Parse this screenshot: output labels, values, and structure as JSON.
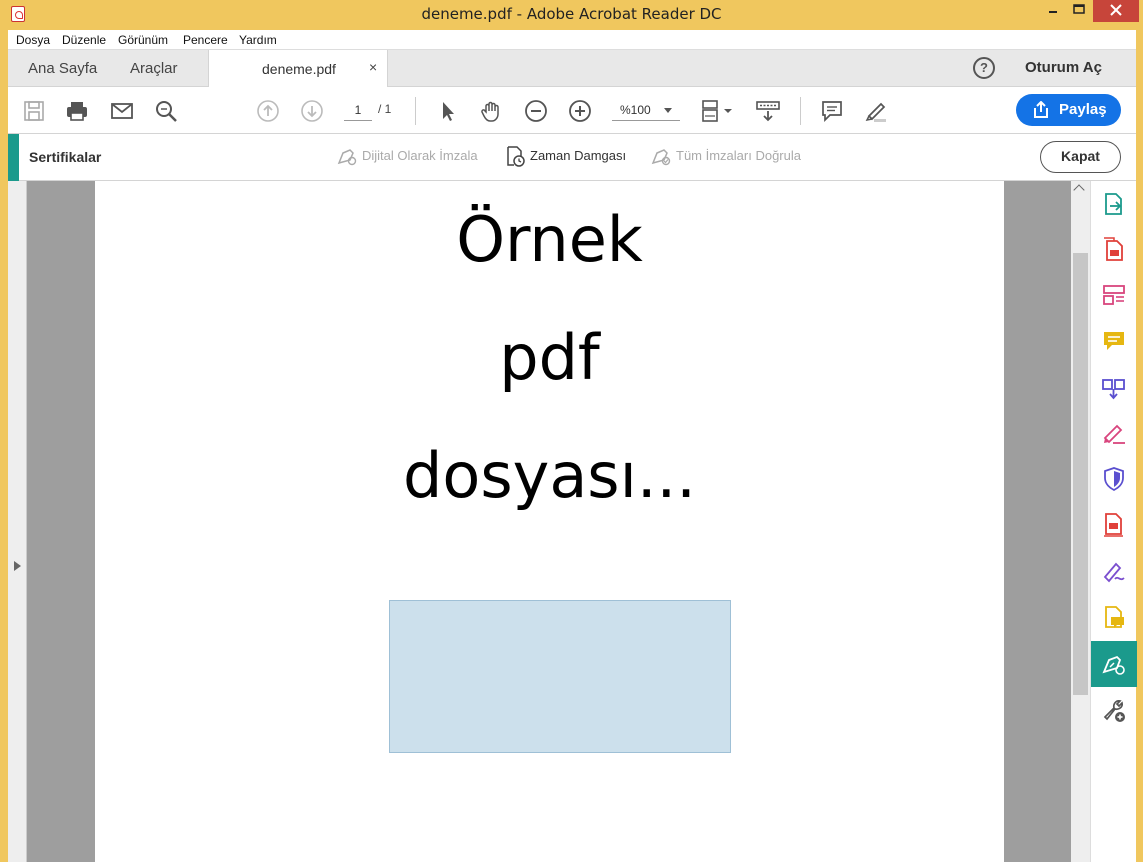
{
  "window": {
    "title": "deneme.pdf - Adobe Acrobat Reader DC",
    "controls": {
      "minimize": "–",
      "maximize": "□",
      "close": "✕"
    }
  },
  "menu": [
    "Dosya",
    "Düzenle",
    "Görünüm",
    "Pencere",
    "Yardım"
  ],
  "tabs": {
    "home": "Ana Sayfa",
    "tools": "Araçlar",
    "document": "deneme.pdf",
    "close_glyph": "×",
    "help_glyph": "?",
    "signin": "Oturum Aç"
  },
  "toolbar": {
    "page_current": "1",
    "page_total": "/ 1",
    "zoom": "%100",
    "share_label": "Paylaş"
  },
  "certificates_bar": {
    "title": "Sertifikalar",
    "digital_sign": "Dijital Olarak İmzala",
    "timestamp": "Zaman Damgası",
    "validate_all": "Tüm İmzaları Doğrula",
    "close_label": "Kapat"
  },
  "document": {
    "lines": [
      "Örnek",
      "pdf",
      "dosyası..."
    ]
  },
  "colors": {
    "accent": "#1b9a8c",
    "share": "#1473e6",
    "signature_box": "#cce0ec"
  },
  "right_rail_icons": [
    "export-pdf-icon",
    "create-pdf-icon",
    "edit-pdf-icon",
    "comment-icon",
    "organize-pages-icon",
    "fill-sign-icon",
    "protect-icon",
    "compress-pdf-icon",
    "request-signature-icon",
    "send-for-comments-icon",
    "certificates-icon",
    "more-tools-icon"
  ]
}
